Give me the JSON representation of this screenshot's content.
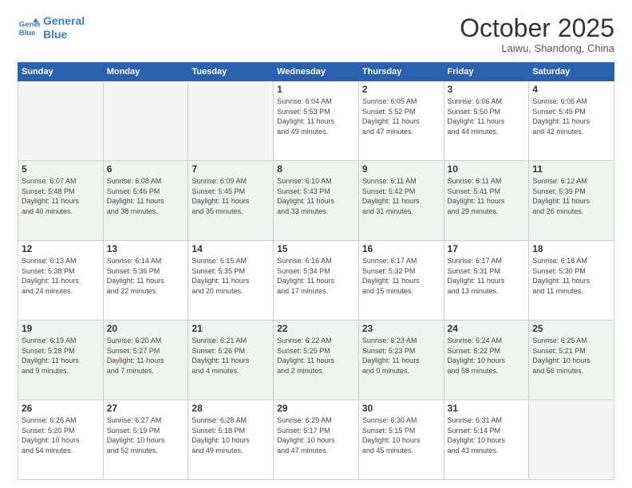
{
  "header": {
    "logo_line1": "General",
    "logo_line2": "Blue",
    "month": "October 2025",
    "location": "Laiwu, Shandong, China"
  },
  "weekdays": [
    "Sunday",
    "Monday",
    "Tuesday",
    "Wednesday",
    "Thursday",
    "Friday",
    "Saturday"
  ],
  "weeks": [
    [
      {
        "day": "",
        "info": ""
      },
      {
        "day": "",
        "info": ""
      },
      {
        "day": "",
        "info": ""
      },
      {
        "day": "1",
        "info": "Sunrise: 6:04 AM\nSunset: 5:53 PM\nDaylight: 11 hours\nand 49 minutes."
      },
      {
        "day": "2",
        "info": "Sunrise: 6:05 AM\nSunset: 5:52 PM\nDaylight: 11 hours\nand 47 minutes."
      },
      {
        "day": "3",
        "info": "Sunrise: 6:06 AM\nSunset: 5:50 PM\nDaylight: 11 hours\nand 44 minutes."
      },
      {
        "day": "4",
        "info": "Sunrise: 6:06 AM\nSunset: 5:49 PM\nDaylight: 11 hours\nand 42 minutes."
      }
    ],
    [
      {
        "day": "5",
        "info": "Sunrise: 6:07 AM\nSunset: 5:48 PM\nDaylight: 11 hours\nand 40 minutes."
      },
      {
        "day": "6",
        "info": "Sunrise: 6:08 AM\nSunset: 5:46 PM\nDaylight: 11 hours\nand 38 minutes."
      },
      {
        "day": "7",
        "info": "Sunrise: 6:09 AM\nSunset: 5:45 PM\nDaylight: 11 hours\nand 35 minutes."
      },
      {
        "day": "8",
        "info": "Sunrise: 6:10 AM\nSunset: 5:43 PM\nDaylight: 11 hours\nand 33 minutes."
      },
      {
        "day": "9",
        "info": "Sunrise: 6:11 AM\nSunset: 5:42 PM\nDaylight: 11 hours\nand 31 minutes."
      },
      {
        "day": "10",
        "info": "Sunrise: 6:11 AM\nSunset: 5:41 PM\nDaylight: 11 hours\nand 29 minutes."
      },
      {
        "day": "11",
        "info": "Sunrise: 6:12 AM\nSunset: 5:39 PM\nDaylight: 11 hours\nand 26 minutes."
      }
    ],
    [
      {
        "day": "12",
        "info": "Sunrise: 6:13 AM\nSunset: 5:38 PM\nDaylight: 11 hours\nand 24 minutes."
      },
      {
        "day": "13",
        "info": "Sunrise: 6:14 AM\nSunset: 5:36 PM\nDaylight: 11 hours\nand 22 minutes."
      },
      {
        "day": "14",
        "info": "Sunrise: 6:15 AM\nSunset: 5:35 PM\nDaylight: 11 hours\nand 20 minutes."
      },
      {
        "day": "15",
        "info": "Sunrise: 6:16 AM\nSunset: 5:34 PM\nDaylight: 11 hours\nand 17 minutes."
      },
      {
        "day": "16",
        "info": "Sunrise: 6:17 AM\nSunset: 5:32 PM\nDaylight: 11 hours\nand 15 minutes."
      },
      {
        "day": "17",
        "info": "Sunrise: 6:17 AM\nSunset: 5:31 PM\nDaylight: 11 hours\nand 13 minutes."
      },
      {
        "day": "18",
        "info": "Sunrise: 6:18 AM\nSunset: 5:30 PM\nDaylight: 11 hours\nand 11 minutes."
      }
    ],
    [
      {
        "day": "19",
        "info": "Sunrise: 6:19 AM\nSunset: 5:28 PM\nDaylight: 11 hours\nand 9 minutes."
      },
      {
        "day": "20",
        "info": "Sunrise: 6:20 AM\nSunset: 5:27 PM\nDaylight: 11 hours\nand 7 minutes."
      },
      {
        "day": "21",
        "info": "Sunrise: 6:21 AM\nSunset: 5:26 PM\nDaylight: 11 hours\nand 4 minutes."
      },
      {
        "day": "22",
        "info": "Sunrise: 6:22 AM\nSunset: 5:25 PM\nDaylight: 11 hours\nand 2 minutes."
      },
      {
        "day": "23",
        "info": "Sunrise: 6:23 AM\nSunset: 5:23 PM\nDaylight: 11 hours\nand 0 minutes."
      },
      {
        "day": "24",
        "info": "Sunrise: 6:24 AM\nSunset: 5:22 PM\nDaylight: 10 hours\nand 58 minutes."
      },
      {
        "day": "25",
        "info": "Sunrise: 6:25 AM\nSunset: 5:21 PM\nDaylight: 10 hours\nand 56 minutes."
      }
    ],
    [
      {
        "day": "26",
        "info": "Sunrise: 6:26 AM\nSunset: 5:20 PM\nDaylight: 10 hours\nand 54 minutes."
      },
      {
        "day": "27",
        "info": "Sunrise: 6:27 AM\nSunset: 5:19 PM\nDaylight: 10 hours\nand 52 minutes."
      },
      {
        "day": "28",
        "info": "Sunrise: 6:28 AM\nSunset: 5:18 PM\nDaylight: 10 hours\nand 49 minutes."
      },
      {
        "day": "29",
        "info": "Sunrise: 6:29 AM\nSunset: 5:17 PM\nDaylight: 10 hours\nand 47 minutes."
      },
      {
        "day": "30",
        "info": "Sunrise: 6:30 AM\nSunset: 5:15 PM\nDaylight: 10 hours\nand 45 minutes."
      },
      {
        "day": "31",
        "info": "Sunrise: 6:31 AM\nSunset: 5:14 PM\nDaylight: 10 hours\nand 43 minutes."
      },
      {
        "day": "",
        "info": ""
      }
    ]
  ]
}
